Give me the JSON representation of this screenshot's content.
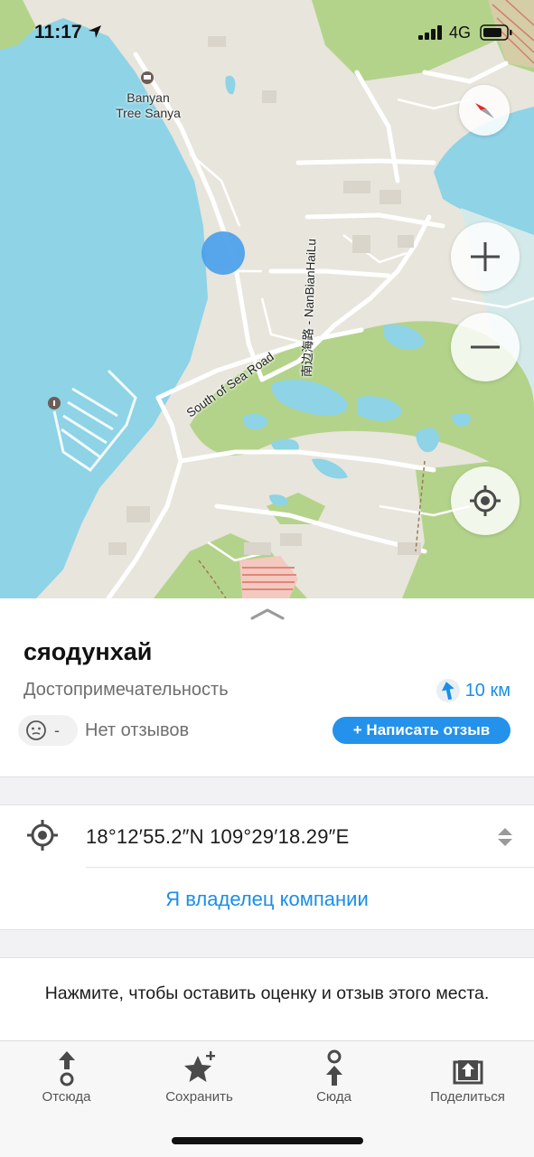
{
  "status_bar": {
    "time": "11:17",
    "network": "4G",
    "icons": [
      "location-arrow-icon",
      "signal-bars-icon",
      "battery-icon"
    ]
  },
  "map": {
    "poi_labels": [
      "Banyan\nTree Sanya"
    ],
    "road_labels": [
      "South of Sea Road",
      "南边海路 - NanBianHaiLu"
    ],
    "controls": [
      "compass-icon",
      "zoom-in-icon",
      "zoom-out-icon",
      "my-location-icon"
    ],
    "colors": {
      "water": "#8ed3e6",
      "land": "#e8e5dc",
      "park": "#b3d38a",
      "user_dot": "#4aa0ea"
    }
  },
  "place": {
    "title": "сяодунхай",
    "type": "Достопримечательность",
    "distance": "10 км",
    "rating_value": "-",
    "reviews": "Нет отзывов",
    "write_review": "+ Написать отзыв"
  },
  "details": {
    "coordinates": "18°12′55.2″N 109°29′18.29″E",
    "owner_link": "Я владелец компании",
    "rate_prompt": "Нажмите, чтобы оставить оценку и отзыв этого места."
  },
  "tabbar": {
    "items": [
      {
        "label": "Отсюда",
        "icon": "route-from-icon"
      },
      {
        "label": "Сохранить",
        "icon": "star-plus-icon"
      },
      {
        "label": "Сюда",
        "icon": "route-to-icon"
      },
      {
        "label": "Поделиться",
        "icon": "share-icon"
      }
    ]
  },
  "colors": {
    "accent": "#1a8ee6",
    "button": "#2492ea"
  }
}
